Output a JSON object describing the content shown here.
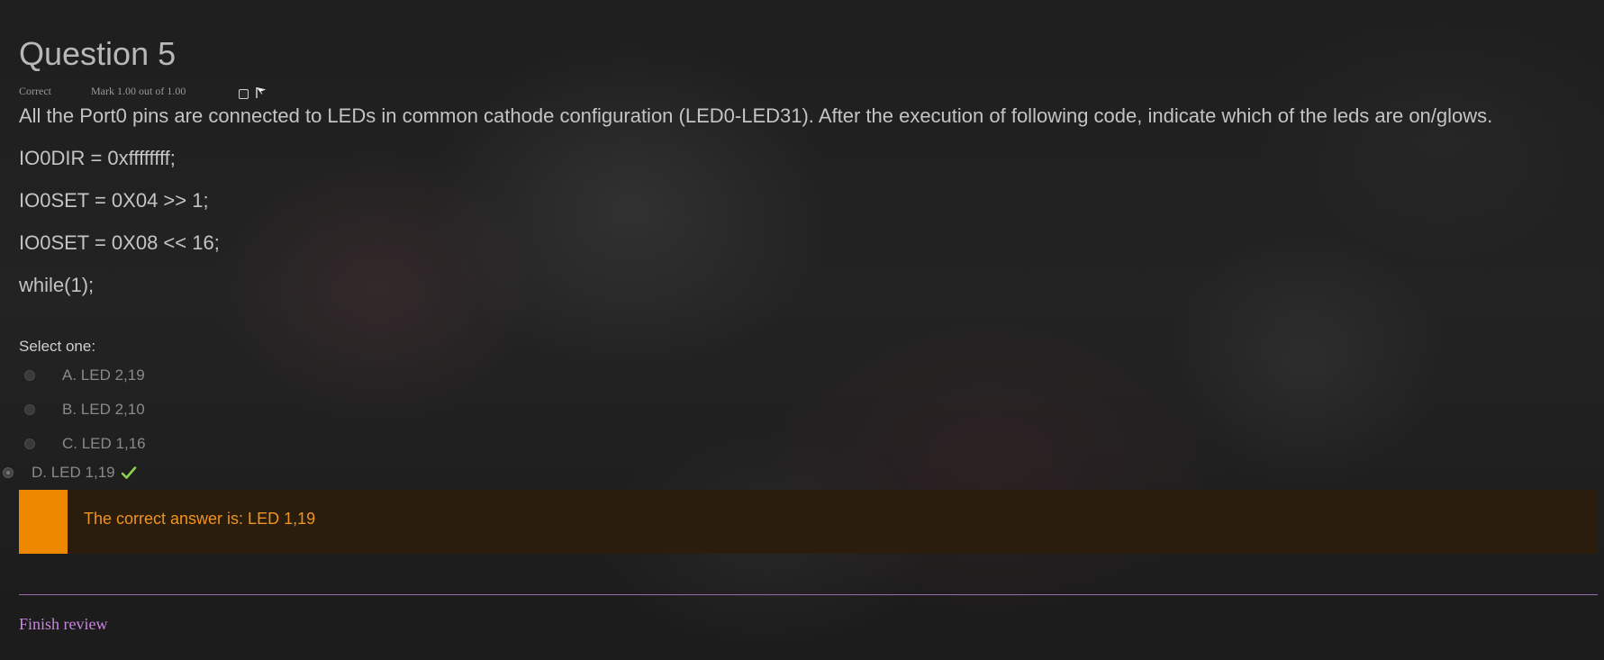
{
  "question": {
    "title": "Question 5",
    "state": "Correct",
    "grade": "Mark 1.00 out of 1.00",
    "text": "All the Port0 pins are connected to LEDs in common cathode configuration (LED0-LED31). After the execution of following code, indicate which of the leds are on/glows.",
    "code_lines": [
      "IO0DIR = 0xffffffff;",
      "IO0SET = 0X04 >> 1;",
      "IO0SET = 0X08 << 16;",
      "while(1);"
    ],
    "prompt": "Select one:",
    "options": [
      {
        "label": "A. LED 2,19"
      },
      {
        "label": "B. LED 2,10"
      },
      {
        "label": "C. LED 1,16"
      },
      {
        "label": "D. LED 1,19",
        "selected": true,
        "correct": true
      }
    ],
    "flag_icon": "flag-icon",
    "check_icon": "check-icon"
  },
  "feedback": {
    "right_answer": "The correct answer is: LED 1,19",
    "accent_color": "#ee8800"
  },
  "footer": {
    "finish_review": "Finish review",
    "link_color": "#c986df"
  }
}
